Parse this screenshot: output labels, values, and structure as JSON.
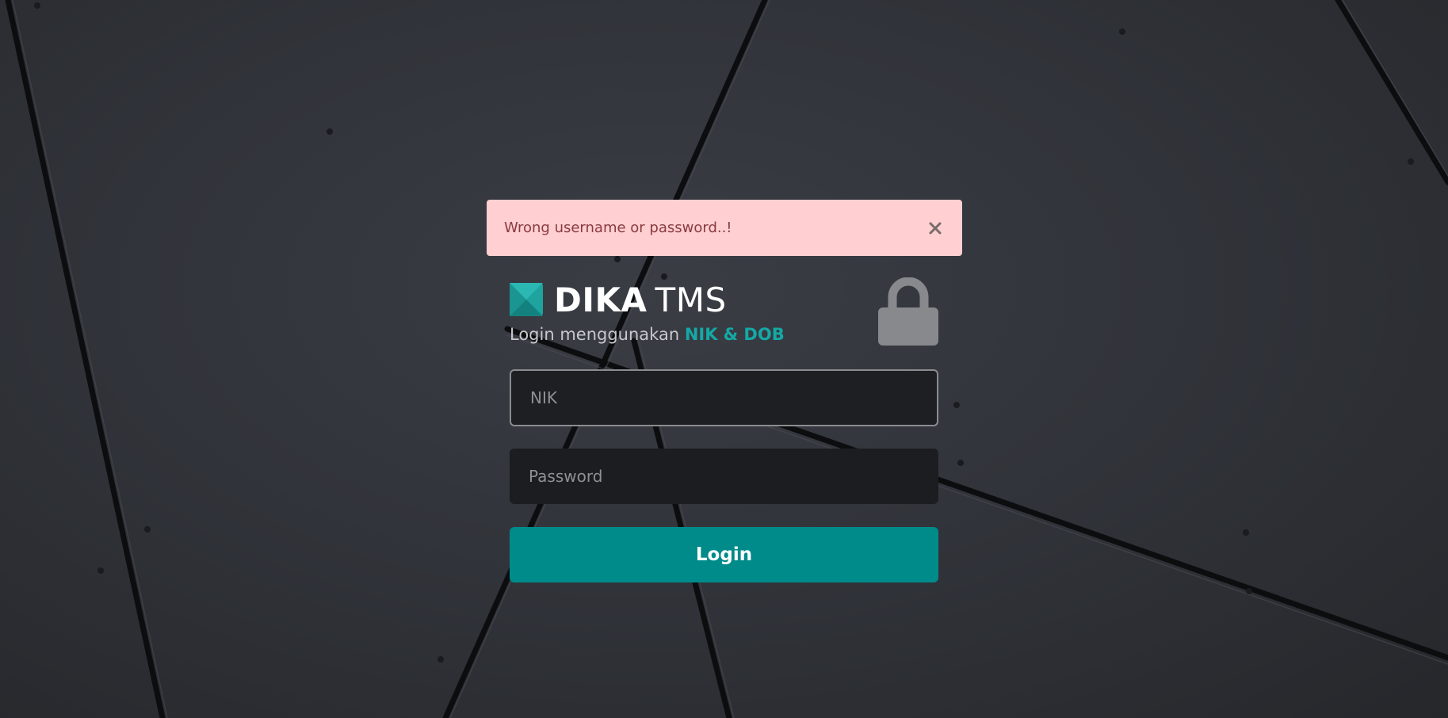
{
  "alert": {
    "message": "Wrong username or password..!",
    "close_icon": "close-icon"
  },
  "brand": {
    "name_strong": "DIKA",
    "name_light": "TMS",
    "logo_color": "#1ea39f"
  },
  "subtitle": {
    "prefix": "Login menggunakan",
    "highlight": "NIK & DOB"
  },
  "form": {
    "nik_placeholder": "NIK",
    "nik_value": "",
    "password_placeholder": "Password",
    "password_value": "",
    "login_label": "Login"
  },
  "icons": {
    "lock": "lock-icon"
  },
  "colors": {
    "accent": "#008b8b",
    "highlight": "#14a9a6",
    "alert_bg": "#ffcfd1",
    "alert_text": "#8a3b3f"
  }
}
